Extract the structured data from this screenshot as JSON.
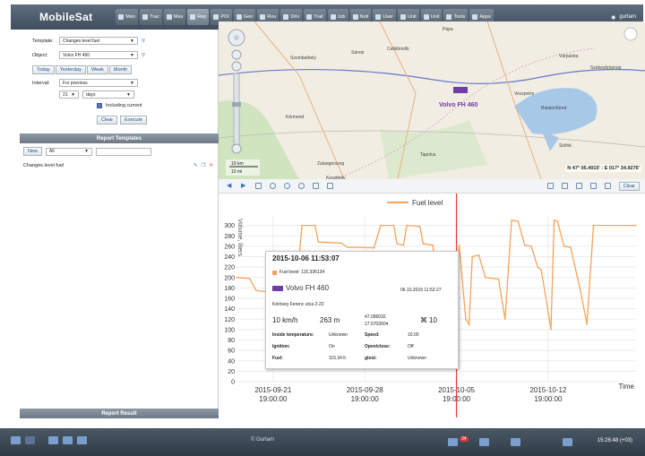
{
  "topbar": {
    "brand": "MobileSat",
    "tabs": [
      "Mon",
      "Trac",
      "Mes",
      "Rep",
      "POI",
      "Geo",
      "Rou",
      "Driv",
      "Trail",
      "Job",
      "Noti",
      "User",
      "Unit",
      "Unit",
      "Tools",
      "Apps"
    ],
    "active_tab": "Rep",
    "user": "gurtam"
  },
  "report": {
    "template_label": "Template:",
    "template_value": "Changes level fuel",
    "object_label": "Object:",
    "object_value": "Volvo FH 460",
    "period_buttons": [
      "Today",
      "Yesterday",
      "Week",
      "Month"
    ],
    "interval_label": "Interval:",
    "interval_value": "For previous",
    "count_value": "21",
    "unit_value": "days",
    "including_current": "Including current",
    "clear": "Clear",
    "execute": "Execute"
  },
  "templates": {
    "header": "Report Templates",
    "new_button": "New",
    "filter_value": "All",
    "items": [
      "Changes level fuel"
    ]
  },
  "report_result": {
    "header": "Report Result"
  },
  "map": {
    "towns": [
      "Pápa",
      "Szombathely",
      "Sárvár",
      "Celldömölk",
      "Várpalota",
      "Székesfehérvár",
      "Veszprém",
      "Balatonfüred",
      "Siófok",
      "Zalaegerszeg",
      "Keszthely",
      "Tapolca",
      "Körmend"
    ],
    "vehicle_label": "Volvo FH 460",
    "scale_km": "10 km",
    "scale_mi": "10 mi",
    "coords": "N 47° 05.4015' : E 017° 34.9276'"
  },
  "toolbar2": {
    "clear": "Clear"
  },
  "chart_data": {
    "type": "line",
    "ylabel": "Volume, liters",
    "xlabel": "Time",
    "legend": [
      "Fuel level"
    ],
    "ylim": [
      0,
      320
    ],
    "yticks": [
      0,
      20,
      40,
      60,
      80,
      100,
      120,
      140,
      160,
      180,
      200,
      220,
      240,
      260,
      280,
      300
    ],
    "xticks": [
      {
        "date": "2015-09-21",
        "time": "19:00:00"
      },
      {
        "date": "2015-09-28",
        "time": "19:00:00"
      },
      {
        "date": "2015-10-05",
        "time": "19:00:00"
      },
      {
        "date": "2015-10-12",
        "time": "19:00:00"
      }
    ],
    "series": [
      {
        "name": "Fuel level",
        "color": "#f5a45a",
        "points": [
          [
            "2015-09-19 00:00",
            200
          ],
          [
            "2015-09-20 00:00",
            198
          ],
          [
            "2015-09-20 12:00",
            175
          ],
          [
            "2015-09-21 12:00",
            172
          ],
          [
            "2015-09-22 00:00",
            160
          ],
          [
            "2015-09-23 12:00",
            158
          ],
          [
            "2015-09-24 00:00",
            300
          ],
          [
            "2015-09-25 00:00",
            300
          ],
          [
            "2015-09-25 06:00",
            268
          ],
          [
            "2015-09-27 00:00",
            266
          ],
          [
            "2015-09-27 12:00",
            258
          ],
          [
            "2015-09-29 12:00",
            257
          ],
          [
            "2015-09-30 00:00",
            300
          ],
          [
            "2015-10-01 00:00",
            300
          ],
          [
            "2015-10-01 06:00",
            265
          ],
          [
            "2015-10-01 18:00",
            262
          ],
          [
            "2015-10-02 00:00",
            300
          ],
          [
            "2015-10-03 00:00",
            298
          ],
          [
            "2015-10-03 06:00",
            265
          ],
          [
            "2015-10-04 00:00",
            262
          ],
          [
            "2015-10-04 12:00",
            60
          ],
          [
            "2015-10-06 00:00",
            262
          ],
          [
            "2015-10-06 12:00",
            120
          ],
          [
            "2015-10-06 18:00",
            110
          ],
          [
            "2015-10-07 00:00",
            240
          ],
          [
            "2015-10-07 12:00",
            243
          ],
          [
            "2015-10-08 00:00",
            200
          ],
          [
            "2015-10-09 00:00",
            197
          ],
          [
            "2015-10-09 12:00",
            120
          ],
          [
            "2015-10-10 00:00",
            310
          ],
          [
            "2015-10-10 12:00",
            308
          ],
          [
            "2015-10-11 00:00",
            262
          ],
          [
            "2015-10-11 12:00",
            260
          ],
          [
            "2015-10-12 00:00",
            220
          ],
          [
            "2015-10-12 06:00",
            215
          ],
          [
            "2015-10-12 12:00",
            180
          ],
          [
            "2015-10-13 00:00",
            100
          ],
          [
            "2015-10-13 06:00",
            310
          ],
          [
            "2015-10-13 12:00",
            308
          ],
          [
            "2015-10-14 00:00",
            260
          ],
          [
            "2015-10-14 12:00",
            258
          ],
          [
            "2015-10-15 06:00",
            175
          ],
          [
            "2015-10-15 18:00",
            110
          ],
          [
            "2015-10-16 06:00",
            300
          ],
          [
            "2015-10-19 12:00",
            300
          ]
        ]
      }
    ],
    "cursor_x": "2015-10-05 19:00",
    "grid": true,
    "legend_position": "top-right"
  },
  "tooltip": {
    "time": "2015-10-06 11:53:07",
    "fuel_level": "Fuel level: 115.336134",
    "vehicle": "Volvo FH 460",
    "vehicle_time": "06.10.2015 11:52:27",
    "address": "Körösey Ferenc utca 2-22",
    "speed": "10 km/h",
    "altitude": "263 m",
    "lat": "47.096032",
    "lon": "17.5703504",
    "satellites": "10",
    "rows": [
      [
        "Inside temperature:",
        "Unknown",
        "Speed:",
        "10.00"
      ],
      [
        "Ignition:",
        "On",
        "Open/close:",
        "Off"
      ],
      [
        "Fuel:",
        "115.34 lt",
        "gtest:",
        "Unknown"
      ]
    ]
  },
  "status": {
    "center": "© Gurtam",
    "badge": "34",
    "clock": "15:26:48 (+03)"
  },
  "colors": {
    "accent": "#4a7bd0",
    "fuel": "#f5a45a",
    "cursor": "#e53935"
  }
}
